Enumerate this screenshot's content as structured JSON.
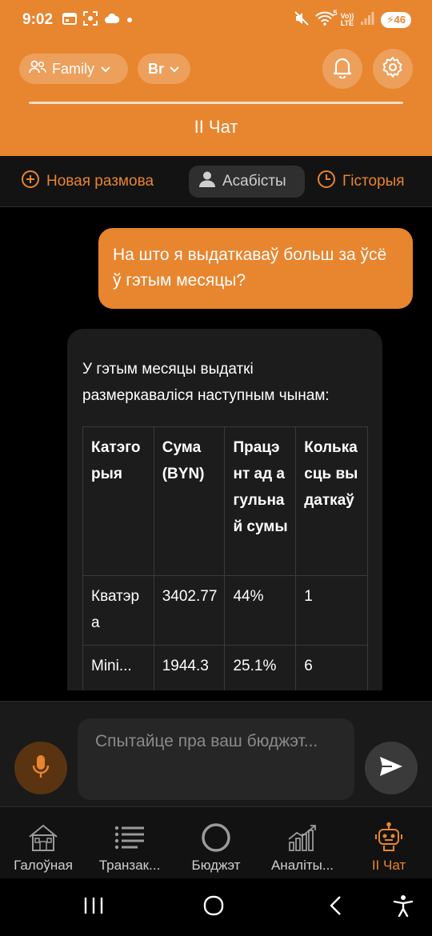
{
  "status_bar": {
    "time": "9:02",
    "network_top": "Vo))",
    "network_bottom": "LTE",
    "wifi_badge": "5",
    "battery": "46"
  },
  "header": {
    "family_label": "Family",
    "currency_label": "Br",
    "title": "ІІ Чат"
  },
  "actions": {
    "new_chat": "Новая размова",
    "personal": "Асабісты",
    "history": "Гісторыя"
  },
  "chat": {
    "user_message": "На што я выдаткаваў больш за ўсё ў гэтым месяцы?",
    "bot_intro": "У гэтым месяцы выдаткі размеркаваліся наступным чынам:",
    "table": {
      "headers": [
        "Катэгорыя",
        "Сума (BYN)",
        "Працэнт ад агульнай сумы",
        "Колькасць выдаткаў"
      ],
      "rows": [
        [
          "Кватэра",
          "3402.77",
          "44%",
          "1"
        ],
        [
          "Mini...",
          "1944.3",
          "25.1%",
          "6"
        ]
      ]
    }
  },
  "input": {
    "placeholder": "Спытайце пра ваш бюджэт..."
  },
  "bottom_nav": {
    "items": [
      "Галоўная",
      "Транзак...",
      "Бюджэт",
      "Аналіты...",
      "ІІ Чат"
    ],
    "active_index": 4
  },
  "colors": {
    "accent": "#E8852F",
    "background": "#000000",
    "bubble_bot": "#1C1C1C"
  }
}
